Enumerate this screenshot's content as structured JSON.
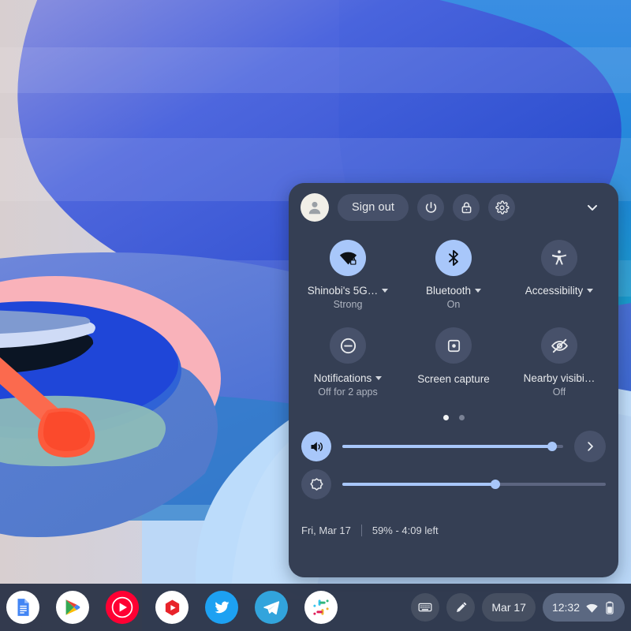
{
  "desktop": {
    "wallpaper_name": "abstract-boat-wallpaper",
    "colors": {
      "sky_light": "#bedcf7",
      "blob_blue": "#2a6fe0",
      "blob_deep": "#1e47c9",
      "blob_cyan": "#1f8ed6",
      "wave_light": "#b9d9f8",
      "boat_pink": "#f7aeb6",
      "oar_red": "#f9553a",
      "water_teal": "#8fc0bd"
    }
  },
  "quick_settings": {
    "header": {
      "avatar_name": "user-avatar",
      "sign_out_label": "Sign out",
      "power_icon": "power-icon",
      "lock_icon": "lock-icon",
      "settings_icon": "gear-icon",
      "collapse_icon": "chevron-down-icon"
    },
    "tiles": [
      {
        "id": "network",
        "icon": "wifi-locked-icon",
        "label": "Shinobi's 5G…",
        "sublabel": "Strong",
        "has_caret": true,
        "state": "on"
      },
      {
        "id": "bluetooth",
        "icon": "bluetooth-icon",
        "label": "Bluetooth",
        "sublabel": "On",
        "has_caret": true,
        "state": "on"
      },
      {
        "id": "accessibility",
        "icon": "accessibility-icon",
        "label": "Accessibility",
        "sublabel": "",
        "has_caret": true,
        "state": "off"
      },
      {
        "id": "notifications",
        "icon": "do-not-disturb-icon",
        "label": "Notifications",
        "sublabel": "Off for 2 apps",
        "has_caret": true,
        "state": "off"
      },
      {
        "id": "screen-capture",
        "icon": "screen-capture-icon",
        "label": "Screen capture",
        "sublabel": "",
        "has_caret": false,
        "state": "off"
      },
      {
        "id": "nearby-visibility",
        "icon": "eye-off-icon",
        "label": "Nearby visibi…",
        "sublabel": "Off",
        "has_caret": false,
        "state": "off"
      }
    ],
    "pagination": {
      "pages": 2,
      "current": 1
    },
    "sliders": [
      {
        "id": "volume",
        "icon": "volume-up-icon",
        "value": 95,
        "state": "on"
      },
      {
        "id": "brightness",
        "icon": "brightness-icon",
        "value": 58,
        "state": "off"
      }
    ],
    "next_page_icon": "chevron-right-icon",
    "footer": {
      "date": "Fri, Mar 17",
      "battery": "59% - 4:09 left"
    }
  },
  "shelf": {
    "apps": [
      {
        "id": "docs",
        "name": "google-docs-icon"
      },
      {
        "id": "play",
        "name": "google-play-icon"
      },
      {
        "id": "ytmusic",
        "name": "youtube-music-icon"
      },
      {
        "id": "hexagon",
        "name": "red-hexagon-app-icon"
      },
      {
        "id": "twitter",
        "name": "twitter-icon"
      },
      {
        "id": "telegram",
        "name": "telegram-icon"
      },
      {
        "id": "slack",
        "name": "slack-icon"
      }
    ],
    "tray": {
      "keyboard_icon": "on-screen-keyboard-icon",
      "stylus_icon": "stylus-icon",
      "calendar_label": "Mar 17",
      "clock": "12:32",
      "wifi_icon": "wifi-icon",
      "battery_icon": "battery-icon"
    }
  }
}
